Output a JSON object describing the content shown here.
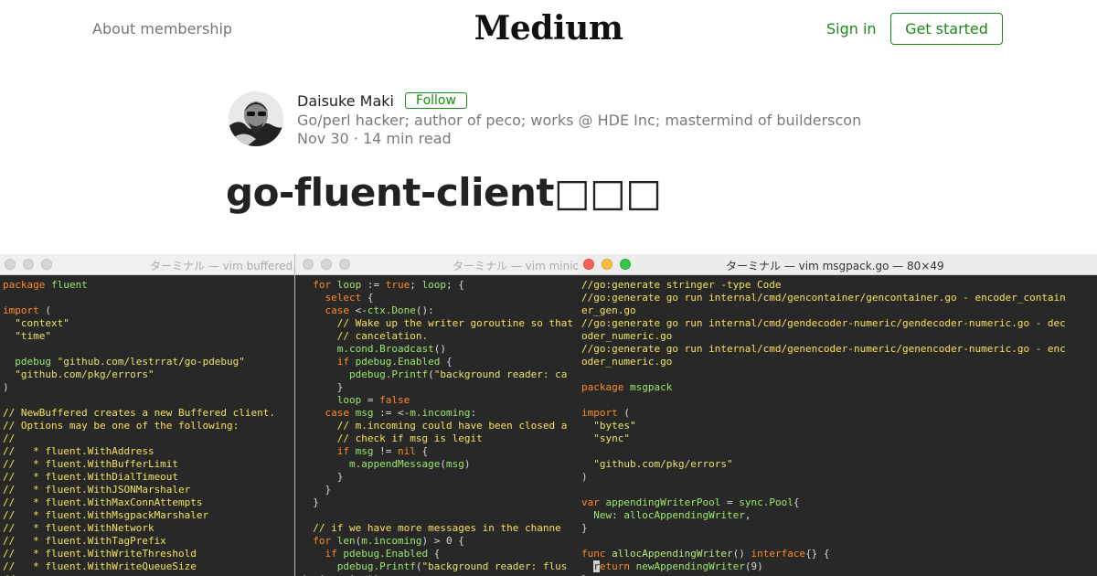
{
  "header": {
    "about_label": "About membership",
    "logo": "Medium",
    "signin_label": "Sign in",
    "get_started_label": "Get started"
  },
  "author": {
    "name": "Daisuke Maki",
    "follow_label": "Follow",
    "bio": "Go/perl hacker; author of peco; works @ HDE Inc; mastermind of builderscon",
    "date": "Nov 30",
    "separator": "·",
    "read_time": "14 min read"
  },
  "article": {
    "title": "go-fluent-client",
    "title_suffix": "□□□"
  },
  "terminals": [
    {
      "title": "ターミナル — vim buffered.",
      "lines": [
        [
          [
            "kw",
            "package"
          ],
          [
            "pl",
            " "
          ],
          [
            "id",
            "fluent"
          ]
        ],
        [],
        [
          [
            "kw",
            "import"
          ],
          [
            "pl",
            " ("
          ]
        ],
        [
          [
            "pl",
            "  "
          ],
          [
            "st",
            "\"context\""
          ]
        ],
        [
          [
            "pl",
            "  "
          ],
          [
            "st",
            "\"time\""
          ]
        ],
        [],
        [
          [
            "pl",
            "  "
          ],
          [
            "id",
            "pdebug"
          ],
          [
            "pl",
            " "
          ],
          [
            "st",
            "\"github.com/lestrrat/go-pdebug\""
          ]
        ],
        [
          [
            "pl",
            "  "
          ],
          [
            "st",
            "\"github.com/pkg/errors\""
          ]
        ],
        [
          [
            "pl",
            ")"
          ]
        ],
        [],
        [
          [
            "cm",
            "// NewBuffered creates a new Buffered client."
          ]
        ],
        [
          [
            "cm",
            "// Options may be one of the following:"
          ]
        ],
        [
          [
            "cm",
            "//"
          ]
        ],
        [
          [
            "cm",
            "//   * fluent.WithAddress"
          ]
        ],
        [
          [
            "cm",
            "//   * fluent.WithBufferLimit"
          ]
        ],
        [
          [
            "cm",
            "//   * fluent.WithDialTimeout"
          ]
        ],
        [
          [
            "cm",
            "//   * fluent.WithJSONMarshaler"
          ]
        ],
        [
          [
            "cm",
            "//   * fluent.WithMaxConnAttempts"
          ]
        ],
        [
          [
            "cm",
            "//   * fluent.WithMsgpackMarshaler"
          ]
        ],
        [
          [
            "cm",
            "//   * fluent.WithNetwork"
          ]
        ],
        [
          [
            "cm",
            "//   * fluent.WithTagPrefix"
          ]
        ],
        [
          [
            "cm",
            "//   * fluent.WithWriteThreshold"
          ]
        ],
        [
          [
            "cm",
            "//   * fluent.WithWriteQueueSize"
          ]
        ],
        [
          [
            "cm",
            "//"
          ]
        ]
      ]
    },
    {
      "title": "ターミナル — vim minion",
      "lines": [
        [
          [
            "pl",
            "  "
          ],
          [
            "kw",
            "for"
          ],
          [
            "pl",
            " "
          ],
          [
            "id",
            "loop"
          ],
          [
            "pl",
            " := "
          ],
          [
            "kw",
            "true"
          ],
          [
            "pl",
            "; "
          ],
          [
            "id",
            "loop"
          ],
          [
            "pl",
            "; {"
          ]
        ],
        [
          [
            "pl",
            "    "
          ],
          [
            "kw",
            "select"
          ],
          [
            "pl",
            " {"
          ]
        ],
        [
          [
            "pl",
            "    "
          ],
          [
            "kw",
            "case"
          ],
          [
            "pl",
            " <-"
          ],
          [
            "id",
            "ctx.Done"
          ],
          [
            "pl",
            "():"
          ]
        ],
        [
          [
            "pl",
            "      "
          ],
          [
            "cm",
            "// Wake up the writer goroutine so that"
          ]
        ],
        [
          [
            "pl",
            "      "
          ],
          [
            "cm",
            "// cancelation."
          ]
        ],
        [
          [
            "pl",
            "      "
          ],
          [
            "id",
            "m.cond.Broadcast"
          ],
          [
            "pl",
            "()"
          ]
        ],
        [
          [
            "pl",
            "      "
          ],
          [
            "kw",
            "if"
          ],
          [
            "pl",
            " "
          ],
          [
            "id",
            "pdebug.Enabled"
          ],
          [
            "pl",
            " {"
          ]
        ],
        [
          [
            "pl",
            "        "
          ],
          [
            "id",
            "pdebug.Printf"
          ],
          [
            "pl",
            "("
          ],
          [
            "st",
            "\"background reader: ca"
          ]
        ],
        [
          [
            "pl",
            "      }"
          ]
        ],
        [
          [
            "pl",
            "      "
          ],
          [
            "id",
            "loop"
          ],
          [
            "pl",
            " = "
          ],
          [
            "kw",
            "false"
          ]
        ],
        [
          [
            "pl",
            "    "
          ],
          [
            "kw",
            "case"
          ],
          [
            "pl",
            " "
          ],
          [
            "id",
            "msg"
          ],
          [
            "pl",
            " := <-"
          ],
          [
            "id",
            "m.incoming"
          ],
          [
            "pl",
            ":"
          ]
        ],
        [
          [
            "pl",
            "      "
          ],
          [
            "cm",
            "// m.incoming could have been closed a"
          ]
        ],
        [
          [
            "pl",
            "      "
          ],
          [
            "cm",
            "// check if msg is legit"
          ]
        ],
        [
          [
            "pl",
            "      "
          ],
          [
            "kw",
            "if"
          ],
          [
            "pl",
            " "
          ],
          [
            "id",
            "msg"
          ],
          [
            "pl",
            " != "
          ],
          [
            "kw",
            "nil"
          ],
          [
            "pl",
            " {"
          ]
        ],
        [
          [
            "pl",
            "        "
          ],
          [
            "id",
            "m.appendMessage"
          ],
          [
            "pl",
            "("
          ],
          [
            "id",
            "msg"
          ],
          [
            "pl",
            ")"
          ]
        ],
        [
          [
            "pl",
            "      }"
          ]
        ],
        [
          [
            "pl",
            "    }"
          ]
        ],
        [
          [
            "pl",
            "  }"
          ]
        ],
        [],
        [
          [
            "pl",
            "  "
          ],
          [
            "cm",
            "// if we have more messages in the channe"
          ]
        ],
        [
          [
            "pl",
            "  "
          ],
          [
            "kw",
            "for"
          ],
          [
            "pl",
            " "
          ],
          [
            "id",
            "len"
          ],
          [
            "pl",
            "("
          ],
          [
            "id",
            "m.incoming"
          ],
          [
            "pl",
            ") > 0 {"
          ]
        ],
        [
          [
            "pl",
            "    "
          ],
          [
            "kw",
            "if"
          ],
          [
            "pl",
            " "
          ],
          [
            "id",
            "pdebug.Enabled"
          ],
          [
            "pl",
            " {"
          ]
        ],
        [
          [
            "pl",
            "      "
          ],
          [
            "id",
            "pdebug.Printf"
          ],
          [
            "pl",
            "("
          ],
          [
            "st",
            "\"background reader: flus"
          ]
        ],
        [
          [
            "pl",
            "(m.incoming))"
          ]
        ]
      ]
    },
    {
      "title": "ターミナル — vim msgpack.go — 80×49",
      "lines": [
        [
          [
            "cm",
            "//go:generate stringer -type Code"
          ]
        ],
        [
          [
            "cm",
            "//go:generate go run internal/cmd/gencontainer/gencontainer.go - encoder_contain"
          ]
        ],
        [
          [
            "cm",
            "er_gen.go"
          ]
        ],
        [
          [
            "cm",
            "//go:generate go run internal/cmd/gendecoder-numeric/gendecoder-numeric.go - dec"
          ]
        ],
        [
          [
            "cm",
            "oder_numeric.go"
          ]
        ],
        [
          [
            "cm",
            "//go:generate go run internal/cmd/genencoder-numeric/genencoder-numeric.go - enc"
          ]
        ],
        [
          [
            "cm",
            "oder_numeric.go"
          ]
        ],
        [],
        [
          [
            "kw",
            "package"
          ],
          [
            "pl",
            " "
          ],
          [
            "id",
            "msgpack"
          ]
        ],
        [],
        [
          [
            "kw",
            "import"
          ],
          [
            "pl",
            " ("
          ]
        ],
        [
          [
            "pl",
            "  "
          ],
          [
            "st",
            "\"bytes\""
          ]
        ],
        [
          [
            "pl",
            "  "
          ],
          [
            "st",
            "\"sync\""
          ]
        ],
        [],
        [
          [
            "pl",
            "  "
          ],
          [
            "st",
            "\"github.com/pkg/errors\""
          ]
        ],
        [
          [
            "pl",
            ")"
          ]
        ],
        [],
        [
          [
            "kw",
            "var"
          ],
          [
            "pl",
            " "
          ],
          [
            "id",
            "appendingWriterPool"
          ],
          [
            "pl",
            " = "
          ],
          [
            "id",
            "sync.Pool"
          ],
          [
            "pl",
            "{"
          ]
        ],
        [
          [
            "pl",
            "  "
          ],
          [
            "id",
            "New"
          ],
          [
            "pl",
            ": "
          ],
          [
            "id",
            "allocAppendingWriter"
          ],
          [
            "pl",
            ","
          ]
        ],
        [
          [
            "pl",
            "}"
          ]
        ],
        [],
        [
          [
            "kw",
            "func"
          ],
          [
            "pl",
            " "
          ],
          [
            "fn",
            "allocAppendingWriter"
          ],
          [
            "pl",
            "() "
          ],
          [
            "kw",
            "interface"
          ],
          [
            "pl",
            "{} {"
          ]
        ],
        [
          [
            "pl",
            "  "
          ],
          [
            "cursor",
            "r"
          ],
          [
            "kw",
            "eturn"
          ],
          [
            "pl",
            " "
          ],
          [
            "id",
            "newAppendingWriter"
          ],
          [
            "pl",
            "(9)"
          ]
        ],
        [
          [
            "pl",
            "}"
          ]
        ]
      ]
    }
  ]
}
